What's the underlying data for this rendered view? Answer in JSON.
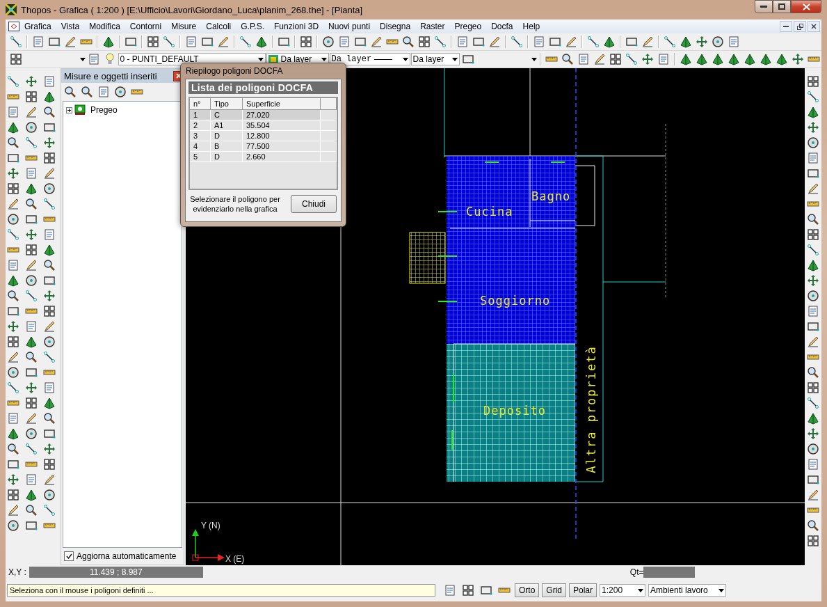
{
  "window": {
    "title": "Thopos - Grafica ( 1:200 ) [E:\\Ufficio\\Lavori\\Giordano_Luca\\planim_268.the] - [Pianta]"
  },
  "menu": [
    "Grafica",
    "Vista",
    "Modifica",
    "Contorni",
    "Misure",
    "Calcoli",
    "G.P.S.",
    "Funzioni 3D",
    "Nuovi punti",
    "Disegna",
    "Raster",
    "Pregeo",
    "Docfa",
    "Help"
  ],
  "layer_toolbar": {
    "layer": "0 - PUNTI_DEFAULT",
    "color_mode": "Da layer",
    "linetype": "Da layer",
    "lineweight": "Da layer"
  },
  "side_panel": {
    "title": "Misure e oggetti inseriti",
    "tree": [
      {
        "label": "Pregeo",
        "expanded": false
      }
    ],
    "auto_update": {
      "label": "Aggiorna automaticamente",
      "checked": true
    }
  },
  "dialog": {
    "title": "Riepilogo poligoni DOCFA",
    "heading": "Lista dei poligoni DOCFA",
    "columns": [
      "n°",
      "Tipo",
      "Superficie"
    ],
    "rows": [
      {
        "cells": [
          "1",
          "C",
          "27.020"
        ],
        "selected": true
      },
      {
        "cells": [
          "2",
          "A1",
          "35.504"
        ],
        "selected": false
      },
      {
        "cells": [
          "3",
          "D",
          "12.800"
        ],
        "selected": false
      },
      {
        "cells": [
          "4",
          "B",
          "77.500"
        ],
        "selected": false
      },
      {
        "cells": [
          "5",
          "D",
          "2.660"
        ],
        "selected": false
      }
    ],
    "hint": "Selezionare il poligono per evidenziarlo nella grafica",
    "close_button": "Chiudi"
  },
  "canvas": {
    "rooms": [
      "Bagno",
      "Cucina",
      "Soggiorno",
      "Deposito"
    ],
    "neighbor": "Altra proprietà",
    "axes": {
      "y": "Y (N)",
      "x": "X (E)"
    }
  },
  "status_bar": {
    "coords_label": "X,Y :",
    "coords": "11.439 ; 8.987",
    "qt_label": "Qt=",
    "message": "Seleziona con il mouse i poligoni definiti ...",
    "toggles": [
      "Orto",
      "Grid",
      "Polar"
    ],
    "scale": "1:200",
    "environment": "Ambienti lavoro"
  }
}
